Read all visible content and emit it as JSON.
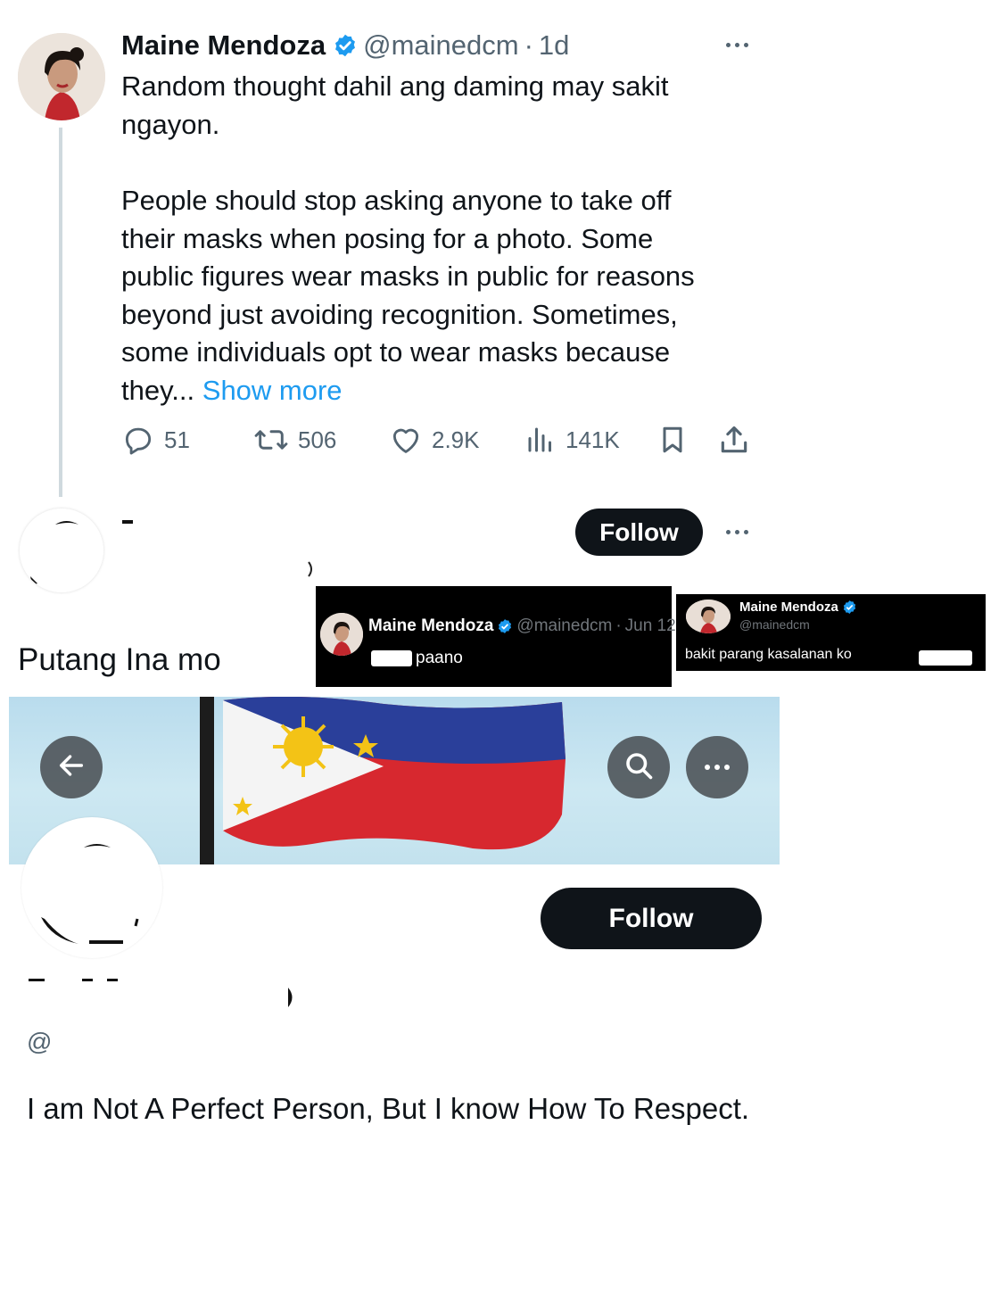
{
  "tweet": {
    "author_name": "Maine Mendoza",
    "handle": "@mainedcm",
    "dot": "·",
    "time": "1d",
    "body_lines": [
      "Random thought dahil ang daming may sakit",
      "ngayon."
    ],
    "body_lines_2": [
      "People should stop asking anyone to take off",
      "their masks when posing for a photo. Some",
      "public figures wear masks in public for reasons",
      "beyond just avoiding recognition. Sometimes,",
      "some individuals opt to wear masks because"
    ],
    "last_line_prefix": "they...",
    "show_more": "Show more",
    "stats": {
      "replies": "51",
      "reposts": "506",
      "likes": "2.9K",
      "views": "141K"
    },
    "colors": {
      "verified": "#1d9bf0",
      "link": "#1d9bf0",
      "muted": "#536471"
    }
  },
  "reply": {
    "follow_label": "Follow",
    "text": "Putang Ina mo"
  },
  "inset1": {
    "name": "Maine Mendoza",
    "handle": "@mainedcm",
    "dot": "·",
    "date": "Jun 12",
    "text": "paano"
  },
  "inset2": {
    "name": "Maine Mendoza",
    "handle": "@mainedcm",
    "text": "bakit parang kasalanan ko"
  },
  "profile": {
    "follow_label": "Follow",
    "at_sign": "@",
    "bio": "I am Not A Perfect Person, But I know How To Respect.",
    "icons": [
      "back-arrow-icon",
      "search-icon",
      "more-icon"
    ]
  }
}
